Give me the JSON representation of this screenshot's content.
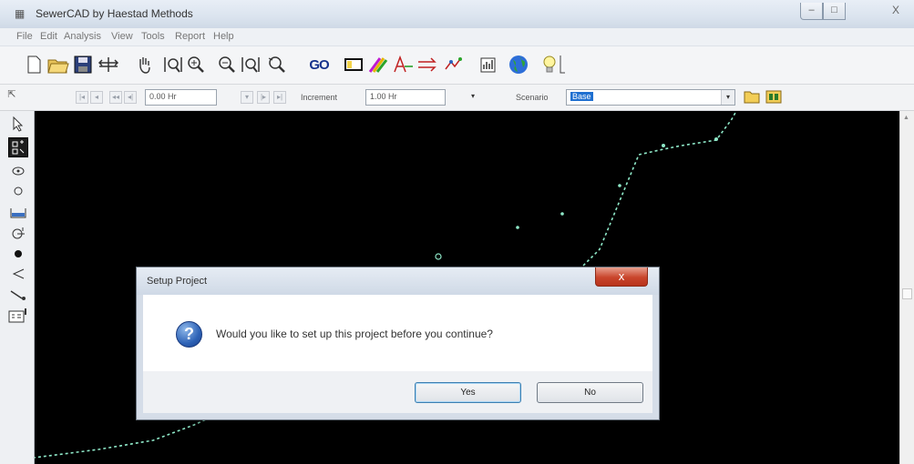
{
  "window": {
    "title": "SewerCAD by Haestad Methods",
    "app_icon": "haestad-logo-icon",
    "controls": {
      "minimize": "–",
      "maximize": "□",
      "close": "X"
    }
  },
  "menu": [
    "File",
    "Edit",
    "Analysis",
    "View",
    "Tools",
    "Report",
    "Help"
  ],
  "toolbar": {
    "buttons": [
      "new-file-icon",
      "open-folder-icon",
      "save-icon",
      "print-icon",
      "pan-hand-icon",
      "zoom-extents-icon",
      "zoom-in-icon",
      "zoom-out-icon",
      "zoom-window-icon",
      "zoom-previous-icon",
      "go-icon",
      "scenario-manager-icon",
      "color-coding-icon",
      "annotation-icon",
      "profile-icon",
      "flextable-icon",
      "report-icon",
      "globe-icon",
      "hint-bulb-icon"
    ],
    "go_label": "GO"
  },
  "time_toolbar": {
    "time_value": "0.00 Hr",
    "increment_label": "Increment",
    "increment_value": "1.00 Hr",
    "scenario_label": "Scenario",
    "scenario_value": "Base"
  },
  "palette": [
    "select-arrow-icon",
    "layout-icon",
    "manhole-icon",
    "junction-icon",
    "wet-well-icon",
    "pump-icon",
    "outlet-icon",
    "outfall-icon",
    "pipe-icon",
    "annotation-text-icon"
  ],
  "dialog": {
    "title": "Setup Project",
    "message": "Would you like to set up this project before you continue?",
    "icon": "question-icon",
    "yes_label": "Yes",
    "no_label": "No",
    "close_label": "x"
  },
  "colors": {
    "canvas_background": "#000000",
    "network_line": "#8ee8c8",
    "dialog_close": "#c9452c"
  }
}
